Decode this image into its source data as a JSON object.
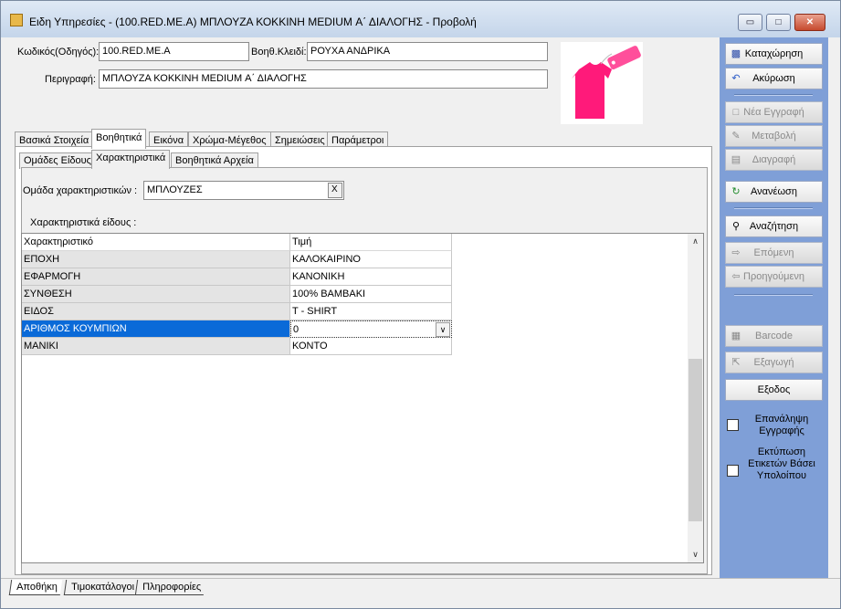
{
  "window": {
    "title": "Ειδη Υπηρεσίες - (100.RED.ME.A) ΜΠΛΟΥΖΑ  ΚΟΚΚΙΝΗ MEDIUM Α΄ ΔΙΑΛΟΓΗΣ -  Προβολή",
    "minimize": "▭",
    "maximize": "□",
    "close": "✕"
  },
  "form": {
    "code_label": "Κωδικός(Οδηγός):",
    "code_value": "100.RED.ME.A",
    "aux_key_label": "Βοηθ.Κλειδί:",
    "aux_key_value": "ΡΟΥΧΑ ΑΝΔΡΙΚΑ",
    "description_label": "Περιγραφή:",
    "description_value": "ΜΠΛΟΥΖΑ  ΚΟΚΚΙΝΗ MEDIUM Α΄ ΔΙΑΛΟΓΗΣ"
  },
  "tabs": [
    {
      "label": "Βασικά Στοιχεία"
    },
    {
      "label": "Βοηθητικά"
    },
    {
      "label": "Εικόνα"
    },
    {
      "label": "Χρώμα-Μέγεθος"
    },
    {
      "label": "Σημειώσεις"
    },
    {
      "label": "Παράμετροι"
    }
  ],
  "subtabs": [
    {
      "label": "Ομάδες Είδους"
    },
    {
      "label": "Χαρακτηριστικά"
    },
    {
      "label": "Βοηθητικά Αρχεία"
    }
  ],
  "characteristics": {
    "group_label": "Ομάδα χαρακτηριστικών :",
    "group_value": "ΜΠΛΟΥΖΕΣ",
    "clear_btn": "X",
    "section_label": "Χαρακτηριστικά είδους :",
    "col_name": "Χαρακτηριστικό",
    "col_value": "Τιμή",
    "rows": [
      {
        "name": "ΕΠΟΧΗ",
        "value": "ΚΑΛΟΚΑΙΡΙΝΟ"
      },
      {
        "name": "ΕΦΑΡΜΟΓΗ",
        "value": "ΚΑΝΟΝΙΚΗ"
      },
      {
        "name": "ΣΥΝΘΕΣΗ",
        "value": "100% ΒΑΜΒΑΚΙ"
      },
      {
        "name": "ΕΙΔΟΣ",
        "value": "T - SHIRT"
      },
      {
        "name": "ΑΡΙΘΜΟΣ ΚΟΥΜΠΙΩΝ",
        "value": "0"
      },
      {
        "name": "ΜΑΝΙΚΙ",
        "value": "ΚΟΝΤΟ"
      }
    ]
  },
  "actions": {
    "save": "Καταχώρηση",
    "cancel": "Ακύρωση",
    "new": "Νέα Εγγραφή",
    "edit": "Μεταβολή",
    "delete": "Διαγραφή",
    "refresh": "Ανανέωση",
    "search": "Αναζήτηση",
    "next": "Επόμενη",
    "previous": "Προηγούμενη",
    "barcode": "Barcode",
    "export": "Εξαγωγή",
    "exit": "Εξοδος",
    "repeat_record": "Επανάληψη Εγγραφής",
    "print_labels": "Εκτύπωση Ετικετών Βάσει Υπολοίπου"
  },
  "bottom_tabs": [
    {
      "label": "Αποθήκη"
    },
    {
      "label": "Τιμοκατάλογοι"
    },
    {
      "label": "Πληροφορίες"
    }
  ],
  "colors": {
    "accent_panel": "#7f9fd7",
    "selection": "#0a6ad8",
    "tshirt": "#ff1a7a"
  }
}
